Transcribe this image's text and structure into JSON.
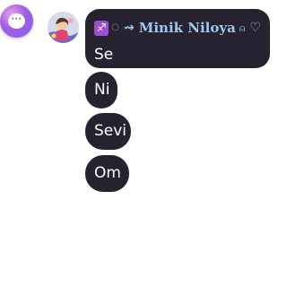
{
  "fab": {
    "icon": "chat-bubble-icon",
    "glyph": "···",
    "gradient_colors": [
      "#e6a3f0",
      "#a15be0",
      "#7d6bf0"
    ]
  },
  "avatar": {
    "icon": "user-avatar-image"
  },
  "messages": [
    {
      "sender": "Minik Niloya",
      "badge": "sagittarius-zodiac-icon",
      "badge_glyph": "♐",
      "ring_glyph": "○",
      "arrow_glyph": "⇝",
      "bell_glyph": "⍝",
      "heart_glyph": "♡",
      "text": "Se"
    },
    {
      "text": "Ni"
    },
    {
      "text": "Sevi"
    },
    {
      "text": "Om"
    }
  ],
  "colors": {
    "bubble_bg": "#26222f",
    "bubble_text": "#ffffff",
    "sender_name": "#9fc7ef",
    "zodiac_badge": "#9b4fcf",
    "page_bg": "#ffffff"
  }
}
